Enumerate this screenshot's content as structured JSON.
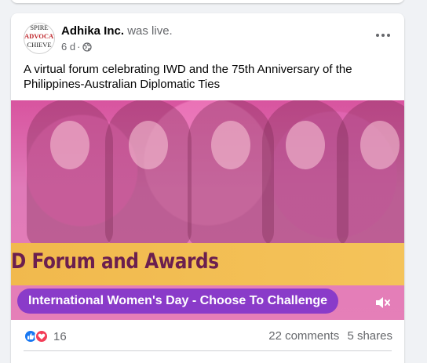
{
  "post": {
    "author": "Adhika Inc.",
    "action": "was live.",
    "avatar_text": [
      "SPIRE",
      "ADVOCATI",
      "CHIEVE"
    ],
    "time": "6 d",
    "separator": "·",
    "caption": "A virtual forum celebrating IWD and the 75th Anniversary of the Philippines-Australian Diplomatic Ties",
    "video": {
      "banner_title": "D Forum and Awards",
      "subtitle": "International Women's Day - Choose To Challenge"
    },
    "reactions_count": "16",
    "comments": "22 comments",
    "shares": "5 shares"
  },
  "icons": {
    "visibility": "globe-icon",
    "menu": "more-options-icon",
    "like": "like-icon",
    "love": "love-icon",
    "volume": "mute-icon"
  },
  "colors": {
    "brand_blue": "#1877f2",
    "love_red": "#f33e58",
    "pill_purple": "#8a3bc9",
    "banner_gold": "#f1b94d",
    "banner_text": "#6b1f4f"
  }
}
